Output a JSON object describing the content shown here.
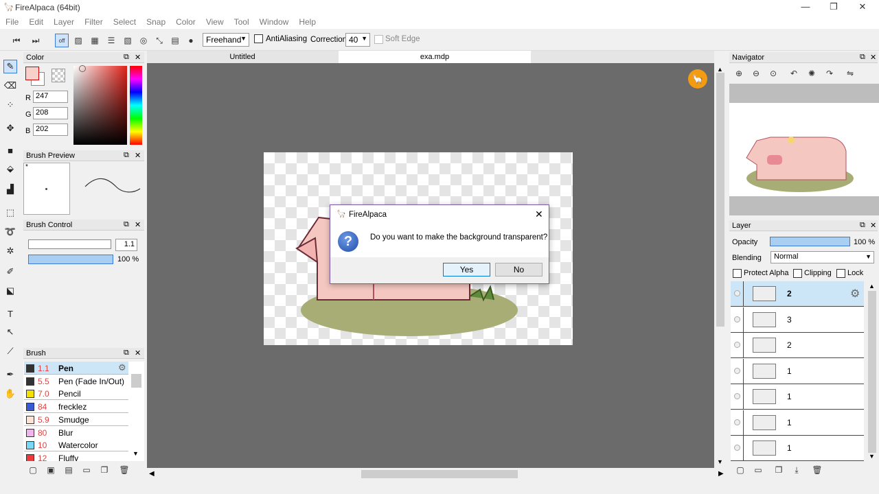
{
  "window": {
    "title": "FireAlpaca (64bit)"
  },
  "menu": [
    "File",
    "Edit",
    "Layer",
    "Filter",
    "Select",
    "Snap",
    "Color",
    "View",
    "Tool",
    "Window",
    "Help"
  ],
  "toolbar": {
    "mode": "Freehand",
    "antialias_label": "AntiAliasing",
    "correction_label": "Correction",
    "correction_value": "40",
    "softedge_label": "Soft Edge",
    "snap_off": "off"
  },
  "color_panel": {
    "title": "Color",
    "r_label": "R",
    "r": "247",
    "g_label": "G",
    "g": "208",
    "b_label": "B",
    "b": "202",
    "fg_color": "#f7d0ca"
  },
  "brush_preview": {
    "title": "Brush Preview",
    "star": "*"
  },
  "brush_control": {
    "title": "Brush Control",
    "size": "1.1",
    "opacity": "100 %"
  },
  "brush_panel": {
    "title": "Brush",
    "items": [
      {
        "size": "1.1",
        "name": "Pen",
        "color": "#333333"
      },
      {
        "size": "5.5",
        "name": "Pen (Fade In/Out)",
        "color": "#333333"
      },
      {
        "size": "7.0",
        "name": "Pencil",
        "color": "#f5e100"
      },
      {
        "size": "84",
        "name": "frecklez",
        "color": "#3a5bd6"
      },
      {
        "size": "5.9",
        "name": "Smudge",
        "color": "#fbe3d6"
      },
      {
        "size": "80",
        "name": "Blur",
        "color": "#f1b5ee"
      },
      {
        "size": "10",
        "name": "Watercolor",
        "color": "#7ad8f7"
      },
      {
        "size": "12",
        "name": "Fluffy",
        "color": "#f03a3a"
      }
    ]
  },
  "tabs": [
    "Untitled",
    "exa.mdp"
  ],
  "dialog": {
    "title": "FireAlpaca",
    "message": "Do you want to make the background transparent?",
    "yes": "Yes",
    "no": "No"
  },
  "navigator": {
    "title": "Navigator"
  },
  "layer_panel": {
    "title": "Layer",
    "opacity_label": "Opacity",
    "opacity_value": "100 %",
    "blending_label": "Blending",
    "blending_value": "Normal",
    "protect_alpha": "Protect Alpha",
    "clipping": "Clipping",
    "lock": "Lock",
    "layers": [
      "2",
      "3",
      "2",
      "1",
      "1",
      "1",
      "1"
    ]
  }
}
